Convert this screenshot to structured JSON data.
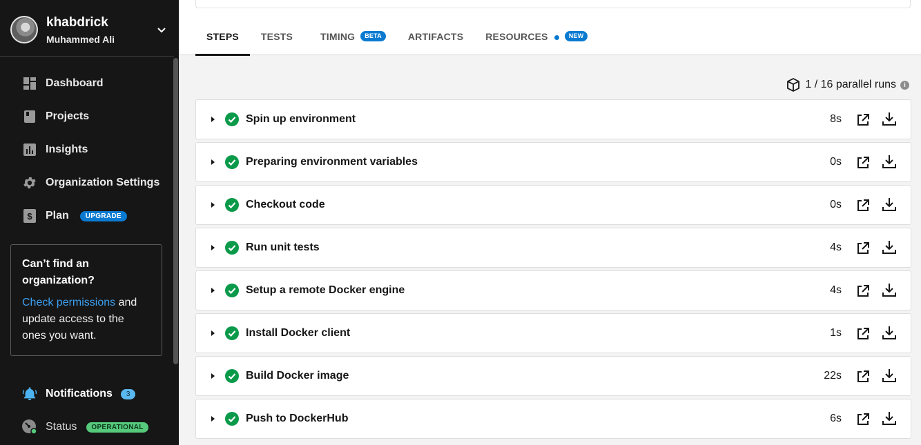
{
  "user": {
    "username": "khabdrick",
    "fullname": "Muhammed Ali"
  },
  "nav": {
    "items": [
      {
        "label": "Dashboard",
        "icon": "dashboard-icon"
      },
      {
        "label": "Projects",
        "icon": "projects-icon"
      },
      {
        "label": "Insights",
        "icon": "insights-icon"
      },
      {
        "label": "Organization Settings",
        "icon": "gear-icon"
      },
      {
        "label": "Plan",
        "icon": "dollar-icon",
        "badge": "UPGRADE"
      }
    ]
  },
  "org_help": {
    "title": "Can’t find an organization?",
    "link": "Check permissions",
    "rest": " and update access to the ones you want."
  },
  "notifications": {
    "label": "Notifications",
    "count": "3"
  },
  "status": {
    "label": "Status",
    "badge": "OPERATIONAL"
  },
  "tabs": [
    {
      "label": "STEPS",
      "active": true
    },
    {
      "label": "TESTS"
    },
    {
      "label": "TIMING",
      "badge": "BETA"
    },
    {
      "label": "ARTIFACTS"
    },
    {
      "label": "RESOURCES",
      "badge": "NEW"
    }
  ],
  "parallel": {
    "label": "1 / 16 parallel runs"
  },
  "steps": [
    {
      "name": "Spin up environment",
      "duration": "8s"
    },
    {
      "name": "Preparing environment variables",
      "duration": "0s"
    },
    {
      "name": "Checkout code",
      "duration": "0s"
    },
    {
      "name": "Run unit tests",
      "duration": "4s"
    },
    {
      "name": "Setup a remote Docker engine",
      "duration": "4s"
    },
    {
      "name": "Install Docker client",
      "duration": "1s"
    },
    {
      "name": "Build Docker image",
      "duration": "22s"
    },
    {
      "name": "Push to DockerHub",
      "duration": "6s"
    }
  ],
  "colors": {
    "sidebar": "#161616",
    "accent": "#0a7ad1",
    "success": "#0a9a4a",
    "operational": "#56c97b"
  }
}
